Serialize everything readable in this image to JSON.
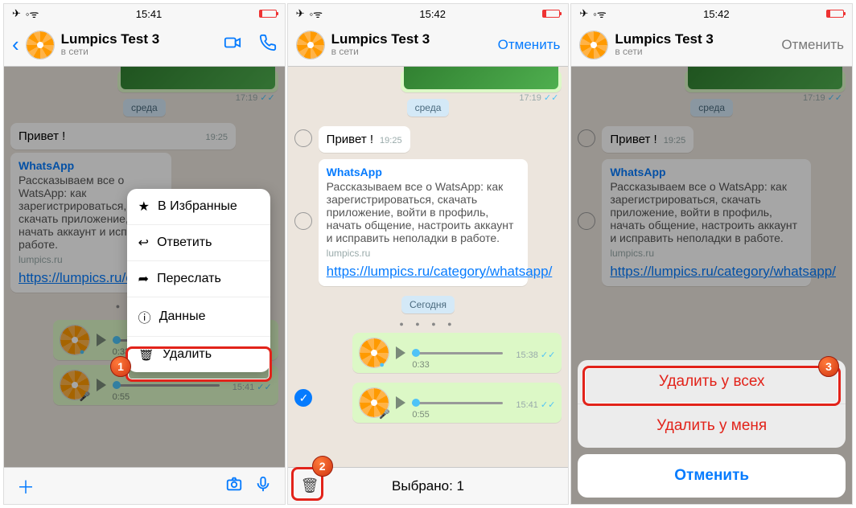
{
  "status": {
    "time1": "15:41",
    "time2": "15:42",
    "time3": "15:42"
  },
  "chat_title": "Lumpics Test 3",
  "presence": "в сети",
  "cancel": "Отменить",
  "day1": "среда",
  "day2": "Сегодня",
  "msg_hello": "Привет !",
  "msg_hello_time": "19:25",
  "img_time": "17:19",
  "link_sender": "WhatsApp",
  "link_body": "Рассказываем все о WatsApp: как зарегистрироваться, скачать приложение, войти в профиль, начать общение, настроить аккаунт и исправить неполадки в работе.",
  "link_body_short": "Рассказываем все о WatsApp: как зарегистрироваться, скачать приложение, во   начать   аккаунт и испра  работе.",
  "link_domain": "lumpics.ru",
  "link_url": "https://lumpics.ru/category/whatsapp/",
  "voice1_dur": "0:33",
  "voice1_time": "15:38",
  "voice2_dur": "0:55",
  "voice2_time": "15:41",
  "dots": "● ● ● ●",
  "ctx": {
    "star": "В Избранные",
    "reply": "Ответить",
    "forward": "Переслать",
    "info": "Данные",
    "delete": "Удалить"
  },
  "selected_label": "Выбрано: 1",
  "sheet": {
    "all": "Удалить у всех",
    "me": "Удалить у меня",
    "cancel": "Отменить"
  },
  "badge1": "1",
  "badge2": "2",
  "badge3": "3"
}
